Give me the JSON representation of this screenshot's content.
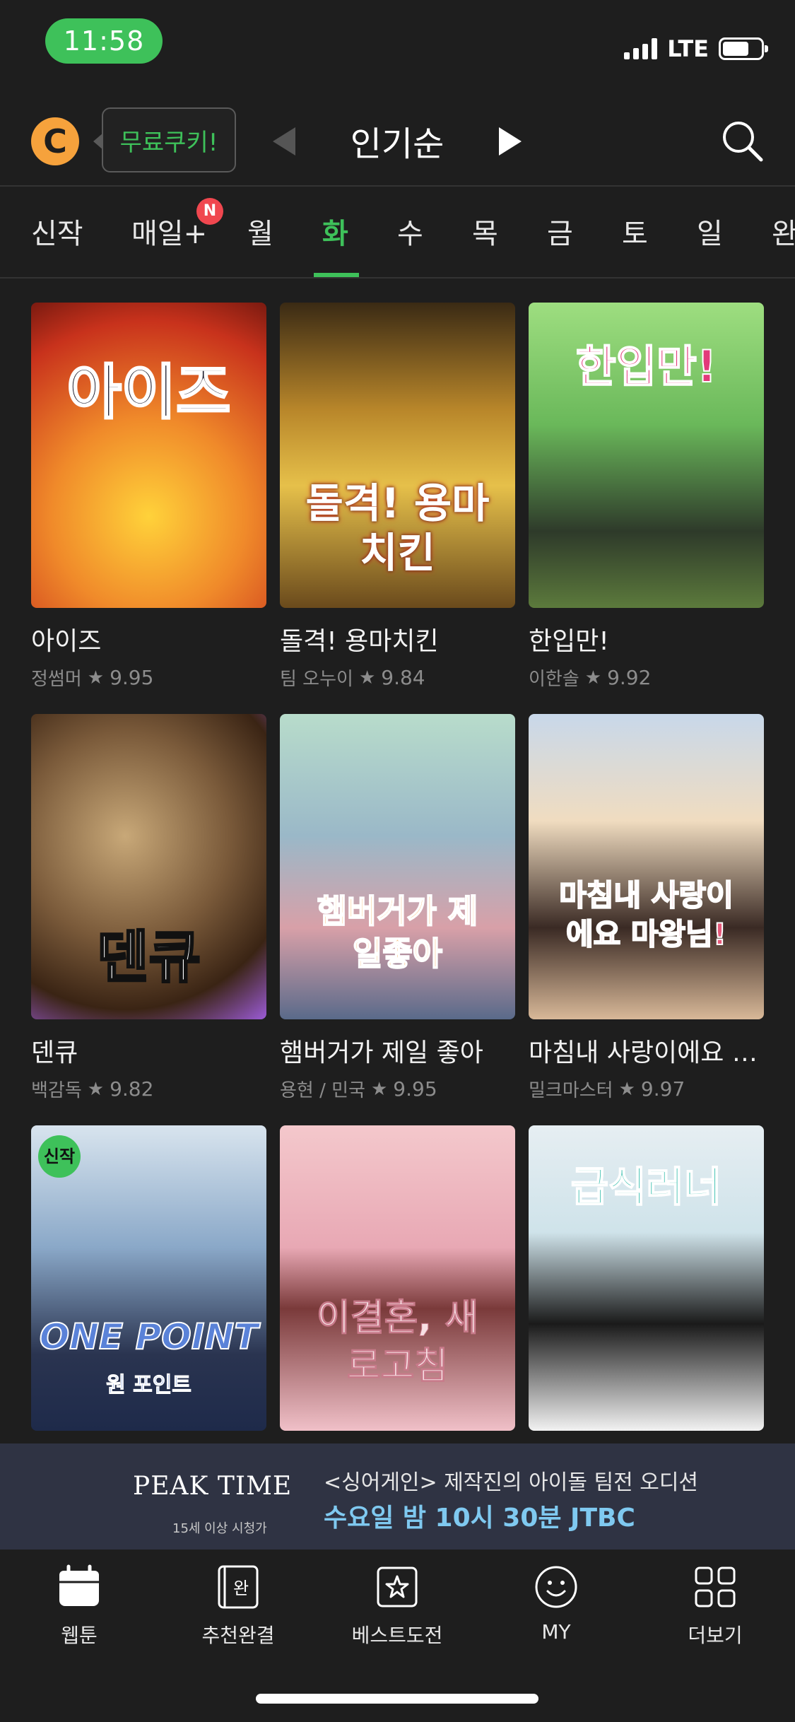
{
  "status_bar": {
    "time": "11:58",
    "network": "LTE"
  },
  "header": {
    "logo_letter": "C",
    "free_cookie_label": "무료쿠키!",
    "sort_label": "인기순"
  },
  "tabs": {
    "items": [
      "신작",
      "매일+",
      "월",
      "화",
      "수",
      "목",
      "금",
      "토",
      "일",
      "완"
    ],
    "active": "화",
    "new_badge": "N"
  },
  "webtoons": [
    {
      "title": "아이즈",
      "author": "정썸머",
      "rating": "9.95",
      "cover_text": "아이즈",
      "accent": "#e8542a"
    },
    {
      "title": "돌격! 용마치킨",
      "author": "팀 오누이",
      "rating": "9.84",
      "cover_text": "돌격! 용마치킨",
      "accent": "#d9a62e"
    },
    {
      "title": "한입만!",
      "author": "이한솔",
      "rating": "9.92",
      "cover_text": "한입만!",
      "accent": "#8fd07a"
    },
    {
      "title": "덴큐",
      "author": "백감독",
      "rating": "9.82",
      "cover_text": "덴큐",
      "accent": "#9b5bd6"
    },
    {
      "title": "햄버거가 제일 좋아",
      "author": "용현 / 민국",
      "rating": "9.95",
      "cover_text": "햄버거가 제일좋아",
      "accent": "#7fb69a"
    },
    {
      "title": "마침내 사랑이에요 마왕님!",
      "author": "밀크마스터",
      "rating": "9.97",
      "cover_text": "마침내 사랑이에요 마왕님!",
      "accent": "#e8c7a0"
    },
    {
      "title": "",
      "author": "",
      "rating": "",
      "cover_text": "ONE POINT",
      "cover_sub": "원 포인트",
      "badge": "신작",
      "accent": "#7d96b8"
    },
    {
      "title": "",
      "author": "",
      "rating": "",
      "cover_text": "이결혼, 새로고침",
      "accent": "#e8a8b4"
    },
    {
      "title": "",
      "author": "",
      "rating": "",
      "cover_text": "급식러너",
      "accent": "#cfe3ea"
    }
  ],
  "ad": {
    "logo": "PEAK TIME",
    "logo_sub": "15세 이상 시청가",
    "line1": "<싱어게인> 제작진의 아이돌 팀전 오디션",
    "line2": "수요일 밤 10시 30분 JTBC"
  },
  "bottom_nav": [
    {
      "label": "웹툰",
      "icon": "calendar-icon"
    },
    {
      "label": "추천완결",
      "icon": "book-complete-icon"
    },
    {
      "label": "베스트도전",
      "icon": "star-box-icon"
    },
    {
      "label": "MY",
      "icon": "smile-icon"
    },
    {
      "label": "더보기",
      "icon": "grid-icon"
    }
  ],
  "colors": {
    "brand_green": "#3ec15a",
    "background": "#1e1e1e",
    "badge_red": "#f0474f",
    "cookie_orange": "#f6a23c"
  }
}
